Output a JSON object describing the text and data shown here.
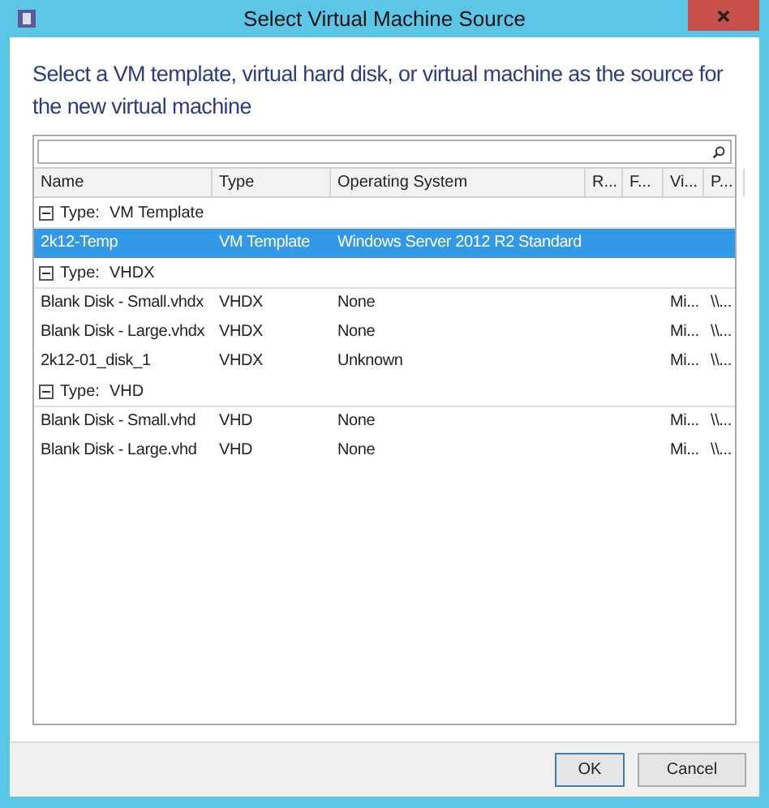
{
  "window": {
    "title": "Select Virtual Machine Source"
  },
  "instruction": "Select a VM template, virtual hard disk, or virtual machine as the source for the new virtual machine",
  "table": {
    "columns": [
      "Name",
      "Type",
      "Operating System",
      "R...",
      "F...",
      "Vi...",
      "P..."
    ],
    "groups": [
      {
        "label": "Type:",
        "value": "VM Template",
        "expanded": true,
        "rows": [
          {
            "cells": [
              "2k12-Temp",
              "VM Template",
              "Windows Server 2012 R2 Standard",
              "",
              "",
              "",
              ""
            ],
            "selected": true
          }
        ]
      },
      {
        "label": "Type:",
        "value": "VHDX",
        "expanded": true,
        "rows": [
          {
            "cells": [
              "Blank Disk - Small.vhdx",
              "VHDX",
              "None",
              "",
              "",
              "Mi...",
              "\\\\..."
            ],
            "selected": false
          },
          {
            "cells": [
              "Blank Disk - Large.vhdx",
              "VHDX",
              "None",
              "",
              "",
              "Mi...",
              "\\\\..."
            ],
            "selected": false
          },
          {
            "cells": [
              "2k12-01_disk_1",
              "VHDX",
              "Unknown",
              "",
              "",
              "Mi...",
              "\\\\..."
            ],
            "selected": false
          }
        ]
      },
      {
        "label": "Type:",
        "value": "VHD",
        "expanded": true,
        "rows": [
          {
            "cells": [
              "Blank Disk - Small.vhd",
              "VHD",
              "None",
              "",
              "",
              "Mi...",
              "\\\\..."
            ],
            "selected": false
          },
          {
            "cells": [
              "Blank Disk - Large.vhd",
              "VHD",
              "None",
              "",
              "",
              "Mi...",
              "\\\\..."
            ],
            "selected": false
          }
        ]
      }
    ]
  },
  "buttons": [
    "OK",
    "Cancel"
  ]
}
